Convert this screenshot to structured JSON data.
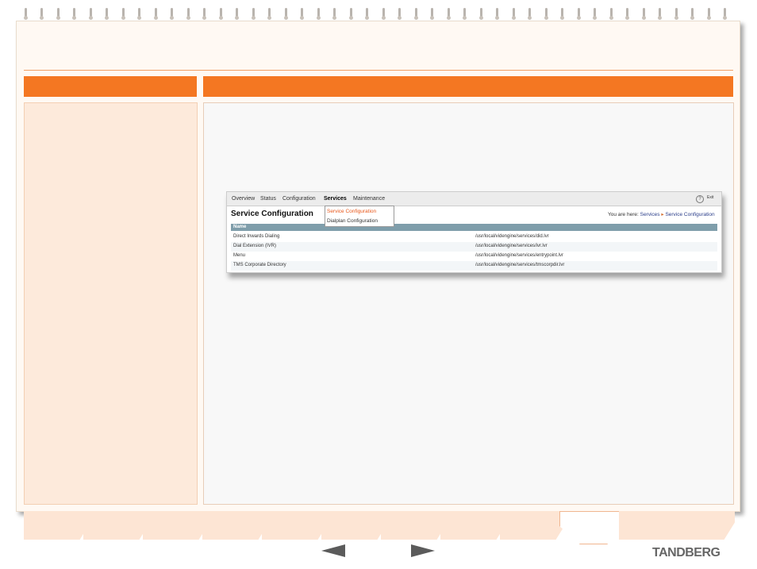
{
  "nav": {
    "items": [
      "Overview",
      "Status",
      "Configuration",
      "Services",
      "Maintenance"
    ],
    "active": "Services",
    "help_icon": "?",
    "exit_label": "Exit"
  },
  "dropdown": {
    "items": [
      "Service Configuration",
      "Dialplan Configuration"
    ],
    "selected": "Service Configuration"
  },
  "page": {
    "title": "Service Configuration",
    "breadcrumb_prefix": "You are here:",
    "breadcrumb": [
      "Services",
      "Service Configuration"
    ],
    "breadcrumb_sep": "▸"
  },
  "table": {
    "header": "Name",
    "rows": [
      {
        "name": "Direct Inwards Dialing",
        "path": "/usr/local/videngine/services/did.lvr"
      },
      {
        "name": "Dial Extension (IVR)",
        "path": "/usr/local/videngine/services/ivr.lvr"
      },
      {
        "name": "Menu",
        "path": "/usr/local/videngine/services/entrypoint.lvr"
      },
      {
        "name": "TMS Corporate Directory",
        "path": "/usr/local/videngine/services/tmscorpdir.lvr"
      }
    ]
  },
  "footer": {
    "brand": "TANDBERG",
    "prev_icon": "left-arrow-icon",
    "next_icon": "right-arrow-icon"
  },
  "colors": {
    "accent": "#f47722",
    "panel_bg": "#fdeadb",
    "table_header": "#7f9eab",
    "link": "#2b3e8a",
    "menu_active": "#e8571a"
  }
}
